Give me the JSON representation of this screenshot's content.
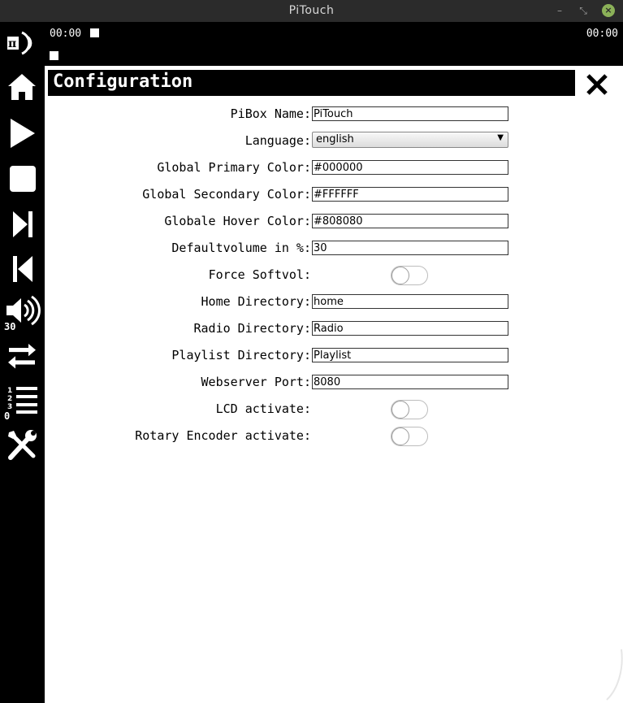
{
  "window": {
    "title": "PiTouch",
    "minimize_glyph": "–",
    "maximize_glyph": "⤡",
    "close_glyph": "×"
  },
  "status": {
    "time_elapsed": "00:00",
    "time_total": "00:00"
  },
  "sidebar": {
    "items": [
      {
        "icon": "pi-logo-icon"
      },
      {
        "icon": "home-icon"
      },
      {
        "icon": "play-icon"
      },
      {
        "icon": "stop-icon"
      },
      {
        "icon": "next-track-icon"
      },
      {
        "icon": "previous-track-icon"
      },
      {
        "icon": "volume-icon",
        "badge": "30"
      },
      {
        "icon": "repeat-icon"
      },
      {
        "icon": "playlist-icon",
        "badge": "0"
      },
      {
        "icon": "settings-tools-icon"
      }
    ]
  },
  "config": {
    "title": "Configuration",
    "fields": [
      {
        "label": "PiBox Name:",
        "type": "text",
        "value": "PiTouch"
      },
      {
        "label": "Language:",
        "type": "select",
        "value": "english"
      },
      {
        "label": "Global Primary Color:",
        "type": "text",
        "value": "#000000"
      },
      {
        "label": "Global Secondary Color:",
        "type": "text",
        "value": "#FFFFFF"
      },
      {
        "label": "Globale Hover Color:",
        "type": "text",
        "value": "#808080"
      },
      {
        "label": "Defaultvolume in %:",
        "type": "text",
        "value": "30"
      },
      {
        "label": "Force Softvol:",
        "type": "toggle",
        "checked": false
      },
      {
        "label": "Home Directory:",
        "type": "text",
        "value": "home"
      },
      {
        "label": "Radio Directory:",
        "type": "text",
        "value": "Radio"
      },
      {
        "label": "Playlist Directory:",
        "type": "text",
        "value": "Playlist"
      },
      {
        "label": "Webserver Port:",
        "type": "text",
        "value": "8080"
      },
      {
        "label": "LCD activate:",
        "type": "toggle",
        "checked": false
      },
      {
        "label": "Rotary Encoder activate:",
        "type": "toggle",
        "checked": false
      }
    ]
  },
  "colors": {
    "background": "#ffffff",
    "panel": "#000000",
    "titlebar": "#2b2b2b",
    "close_button": "#8bb158"
  }
}
